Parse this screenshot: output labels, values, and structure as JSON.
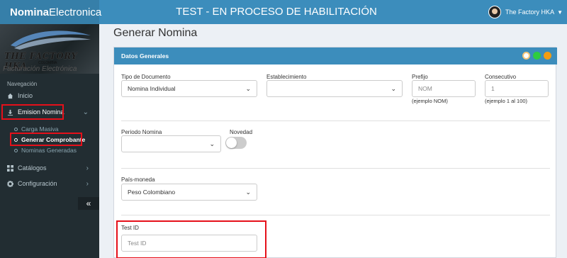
{
  "header": {
    "brand_bold": "Nomina",
    "brand_regular": "Electronica",
    "title": "TEST - EN PROCESO DE HABILITACIÓN",
    "user_name": "The Factory HKA",
    "brand_icon": "square-logo-icon",
    "color": "#3c8dbc"
  },
  "sidebar": {
    "logo": {
      "title": "THE FACTORY HKA",
      "subtitle": "COLOMBIA",
      "tagline": "Facturación Electrónica"
    },
    "nav_header": "Navegación",
    "items": [
      {
        "label": "Inicio",
        "icon": "home-icon"
      },
      {
        "label": "Emision Nomina",
        "icon": "download-icon"
      },
      {
        "label": "Catálogos",
        "icon": "grid-icon"
      },
      {
        "label": "Configuración",
        "icon": "gear-icon"
      }
    ],
    "subitems": [
      {
        "label": "Carga Masiva"
      },
      {
        "label": "Generar Comprobante"
      },
      {
        "label": "Nominas Generadas"
      }
    ],
    "collapse_label": "«"
  },
  "main": {
    "page_title": "Generar Nomina",
    "panel_title": "Datos Generales",
    "form": {
      "tipo_documento": {
        "label": "Tipo de Documento",
        "value": "Nomina Individual"
      },
      "establecimiento": {
        "label": "Establecimiento",
        "value": ""
      },
      "prefijo": {
        "label": "Prefijo",
        "placeholder": "NOM",
        "help": "(ejemplo NOM)"
      },
      "consecutivo": {
        "label": "Consecutivo",
        "placeholder": "1",
        "help": "(ejemplo 1 al 100)"
      },
      "periodo_nomina": {
        "label": "Periodo Nomina",
        "value": ""
      },
      "novedad": {
        "label": "Novedad",
        "checked": false
      },
      "pais_moneda": {
        "label": "País-moneda",
        "value": "Peso Colombiano"
      },
      "test_id": {
        "label": "Test ID",
        "placeholder": "Test ID"
      }
    },
    "tool_colors": [
      "#ffffff",
      "#2ecc40",
      "#f39c12"
    ]
  },
  "colors": {
    "highlight": "#e5101a",
    "sidebar": "#222d32"
  }
}
